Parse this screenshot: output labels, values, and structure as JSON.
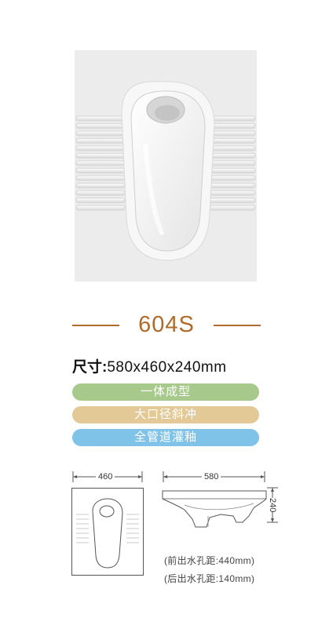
{
  "product": {
    "model": "604S",
    "size_label": "尺寸:",
    "size_value": "580x460x240mm"
  },
  "features": [
    {
      "label": "一体成型",
      "color": "#a8c98c"
    },
    {
      "label": "大口径斜冲",
      "color": "#e3c996"
    },
    {
      "label": "全管道灌釉",
      "color": "#7fc3e8"
    }
  ],
  "diagram": {
    "width_label": "460",
    "length_label": "580",
    "height_label": "240"
  },
  "notes": {
    "front_outlet": "(前出水孔距:440mm)",
    "rear_outlet": "(后出水孔距:140mm)"
  },
  "colors": {
    "accent": "#b06a2a",
    "photo_bg": "#ececec"
  }
}
